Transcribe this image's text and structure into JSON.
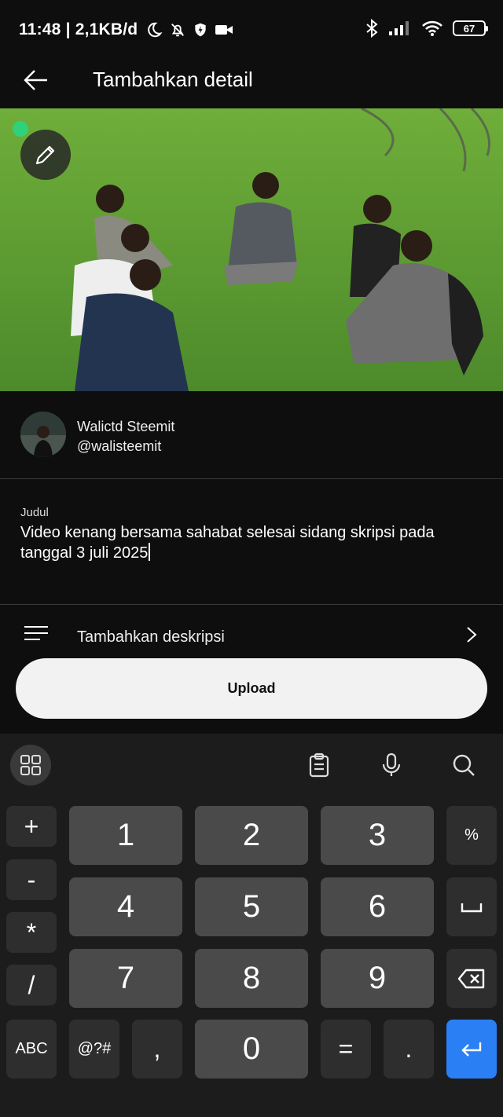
{
  "status_bar": {
    "time_speed": "11:48 | 2,1KB/d",
    "battery_level": "67",
    "icons": [
      "moon-icon",
      "bell-off-icon",
      "shield-icon",
      "video-camera-icon",
      "bluetooth-icon",
      "signal-icon",
      "wifi-icon",
      "battery-icon"
    ]
  },
  "app_bar": {
    "title": "Tambahkan detail"
  },
  "post": {
    "user_name": "Walictd Steemit",
    "user_handle": "@walisteemit",
    "title_label": "Judul",
    "title_value": "Video kenang bersama sahabat selesai sidang skripsi pada tanggal 3 juli 2025",
    "description_placeholder": "Tambahkan deskripsi",
    "upload_label": "Upload"
  },
  "keyboard": {
    "side_left": [
      "+",
      "-",
      "*",
      "/"
    ],
    "digits": [
      "1",
      "2",
      "3",
      "4",
      "5",
      "6",
      "7",
      "8",
      "9"
    ],
    "side_right_top": "%",
    "bottom": {
      "abc": "ABC",
      "symbols": "@?#",
      "comma": ",",
      "zero": "0",
      "equals": "=",
      "dot": "."
    }
  },
  "colors": {
    "accent_enter": "#2a7ff5",
    "background": "#0e0e0e",
    "upload_button": "#f2f2f2"
  }
}
